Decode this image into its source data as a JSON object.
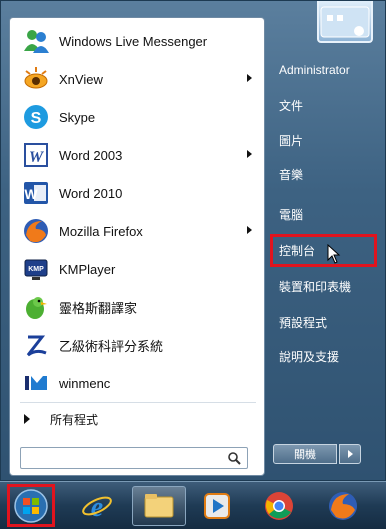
{
  "programs": [
    {
      "label": "Windows Live Messenger",
      "icon": "messenger-icon",
      "submenu": false
    },
    {
      "label": "XnView",
      "icon": "xnview-icon",
      "submenu": true
    },
    {
      "label": "Skype",
      "icon": "skype-icon",
      "submenu": false
    },
    {
      "label": "Word 2003",
      "icon": "word-2003-icon",
      "submenu": true
    },
    {
      "label": "Word 2010",
      "icon": "word-2010-icon",
      "submenu": false
    },
    {
      "label": "Mozilla Firefox",
      "icon": "firefox-icon",
      "submenu": true
    },
    {
      "label": "KMPlayer",
      "icon": "kmplayer-icon",
      "submenu": false
    },
    {
      "label": "靈格斯翻譯家",
      "icon": "lingoes-icon",
      "submenu": false
    },
    {
      "label": "乙級術科評分系統",
      "icon": "grading-system-icon",
      "submenu": false
    },
    {
      "label": "winmenc",
      "icon": "winmenc-icon",
      "submenu": false
    }
  ],
  "all_programs": "所有程式",
  "search": {
    "placeholder": ""
  },
  "right_items": [
    "Administrator",
    "文件",
    "圖片",
    "音樂",
    "電腦",
    "控制台",
    "裝置和印表機",
    "預設程式",
    "說明及支援"
  ],
  "shutdown_label": "關機",
  "taskbar": [
    "start-orb-icon",
    "internet-explorer-icon",
    "file-explorer-icon",
    "media-player-icon",
    "chrome-icon",
    "firefox-icon"
  ],
  "colors": {
    "highlight": "#e0141e",
    "menu_glass": "#3d6282"
  }
}
